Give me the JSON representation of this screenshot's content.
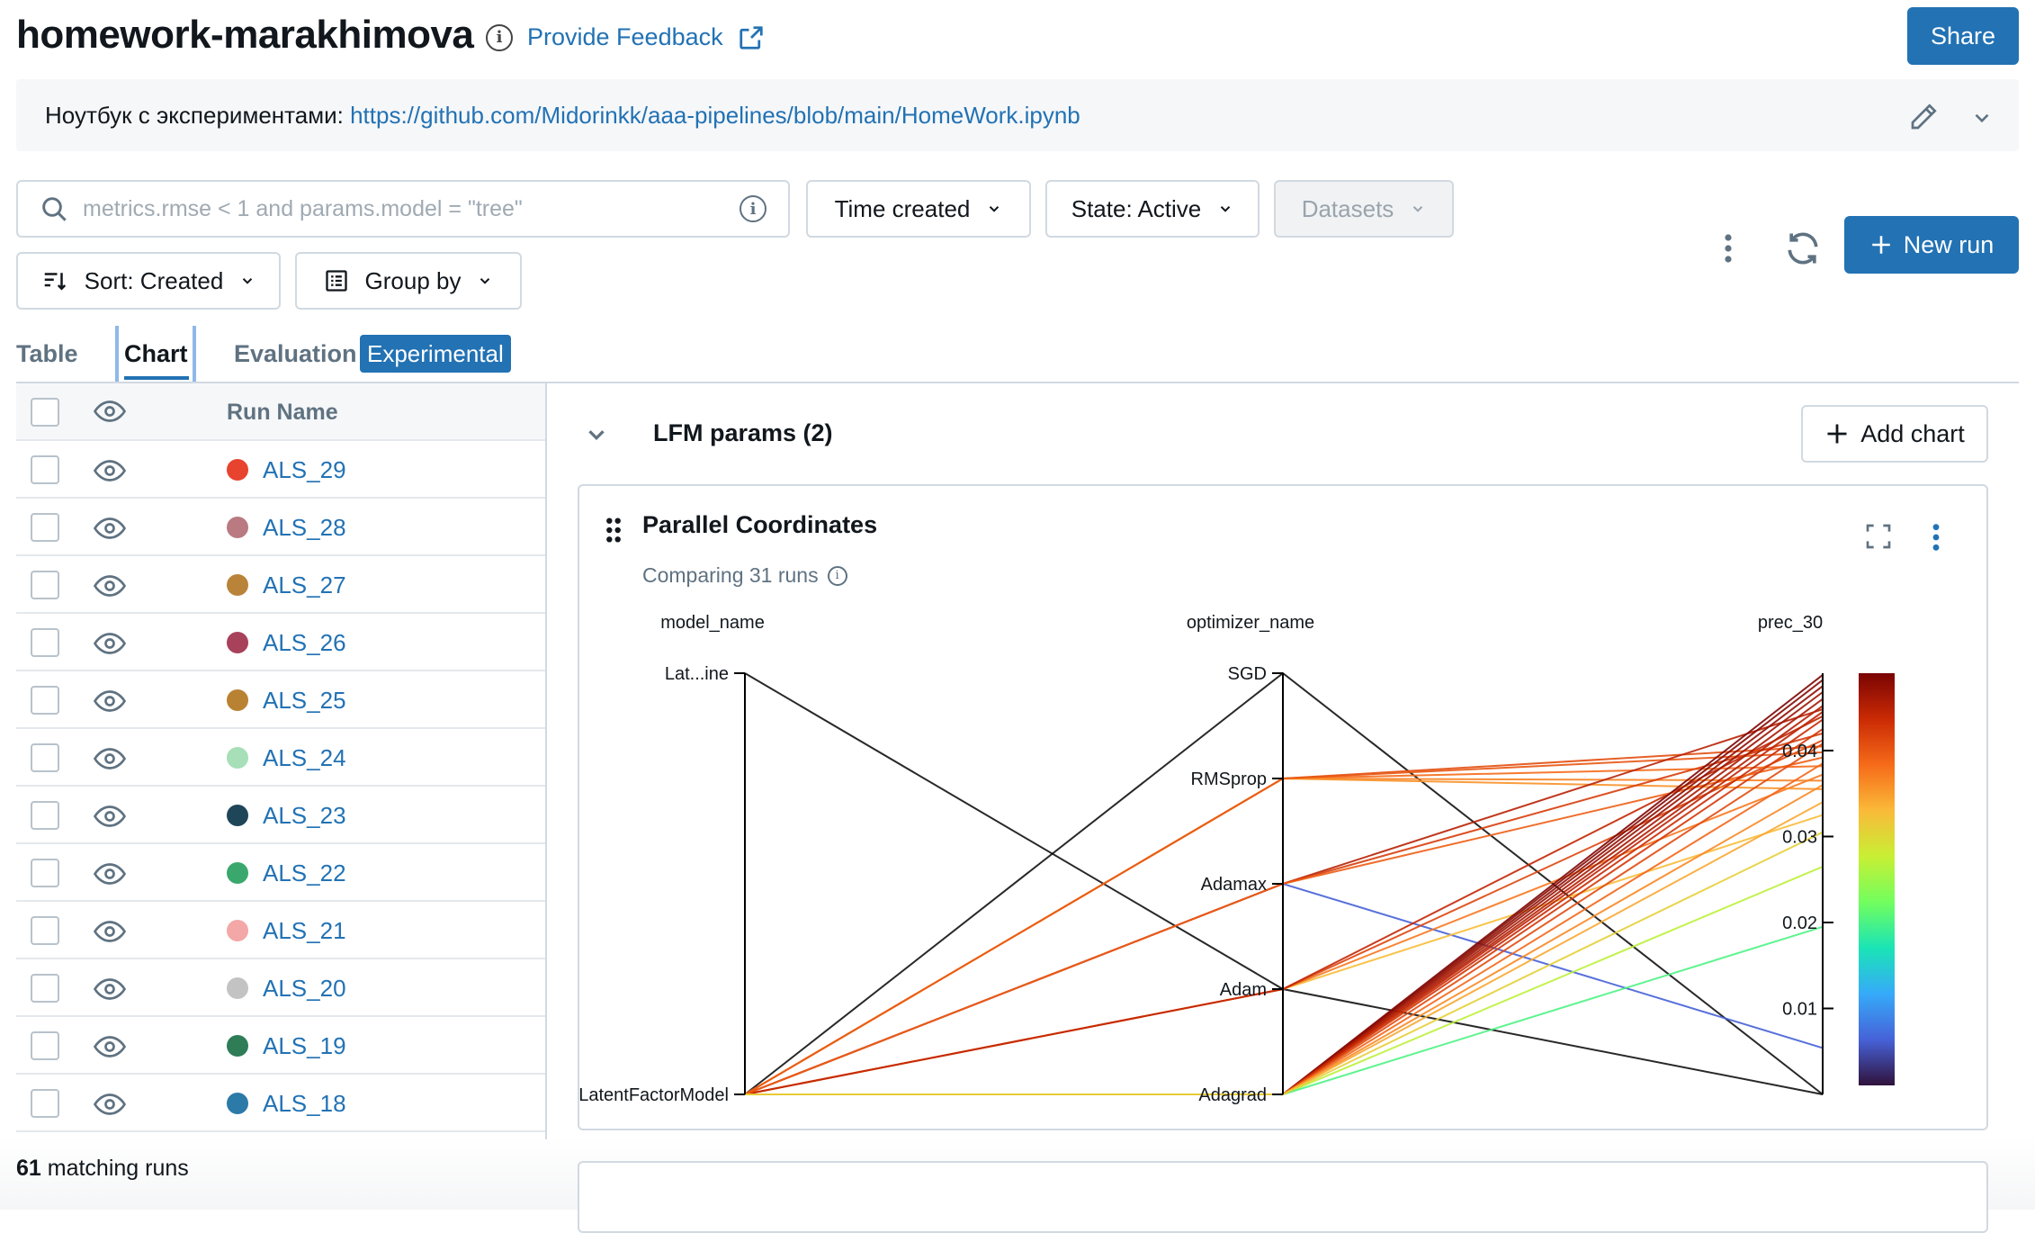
{
  "header": {
    "experiment_name": "homework-marakhimova",
    "feedback_label": "Provide Feedback",
    "share_label": "Share"
  },
  "description": {
    "prefix": "Ноутбук с экспериментами: ",
    "link": "https://github.com/Midorinkk/aaa-pipelines/blob/main/HomeWork.ipynb"
  },
  "controls": {
    "search_placeholder": "metrics.rmse < 1 and params.model = \"tree\"",
    "time_created": "Time created",
    "state": "State: Active",
    "datasets": "Datasets",
    "sort": "Sort: Created",
    "group_by": "Group by",
    "new_run": "New run"
  },
  "tabs": [
    {
      "label": "Table",
      "active": false
    },
    {
      "label": "Chart",
      "active": true
    },
    {
      "label": "Evaluation",
      "active": false
    }
  ],
  "experimental_badge": "Experimental",
  "runs_table": {
    "column_header": "Run Name",
    "rows": [
      {
        "name": "ALS_29",
        "color": "#e8432f"
      },
      {
        "name": "ALS_28",
        "color": "#b97a82"
      },
      {
        "name": "ALS_27",
        "color": "#b9843a"
      },
      {
        "name": "ALS_26",
        "color": "#a8415a"
      },
      {
        "name": "ALS_25",
        "color": "#b98233"
      },
      {
        "name": "ALS_24",
        "color": "#a6dfb8"
      },
      {
        "name": "ALS_23",
        "color": "#1f4559"
      },
      {
        "name": "ALS_22",
        "color": "#3aa86c"
      },
      {
        "name": "ALS_21",
        "color": "#f3a7a7"
      },
      {
        "name": "ALS_20",
        "color": "#c3c3c3"
      },
      {
        "name": "ALS_19",
        "color": "#2e7d57"
      },
      {
        "name": "ALS_18",
        "color": "#2b7aa8"
      }
    ],
    "matching_count": "61",
    "matching_label": " matching runs"
  },
  "chart_section": {
    "title": "LFM params (2)",
    "add_chart": "Add chart"
  },
  "chart_card": {
    "title": "Parallel Coordinates",
    "subtitle": "Comparing 31 runs"
  },
  "chart_data": {
    "type": "parallel_coordinates",
    "axes": [
      {
        "name": "model_name",
        "type": "categorical",
        "categories": [
          "LatentFactorModel",
          "Lat...ine"
        ]
      },
      {
        "name": "optimizer_name",
        "type": "categorical",
        "categories": [
          "Adagrad",
          "Adam",
          "Adamax",
          "RMSprop",
          "SGD"
        ]
      },
      {
        "name": "prec_30",
        "type": "numeric",
        "range": [
          0.0,
          0.049
        ],
        "ticks": [
          0.01,
          0.02,
          0.03,
          0.04
        ]
      }
    ],
    "colorscale": {
      "metric": "prec_30",
      "range": [
        0.0,
        0.049
      ],
      "colors": [
        "#30123b",
        "#4662d8",
        "#36aaf9",
        "#1ae4b6",
        "#72fe5e",
        "#c8ef34",
        "#faba39",
        "#f66b19",
        "#ca2a04",
        "#7a0403"
      ]
    },
    "runs": [
      {
        "model_name": "Lat...ine",
        "optimizer_name": "Adam",
        "prec_30": 0.0
      },
      {
        "model_name": "LatentFactorModel",
        "optimizer_name": "SGD",
        "prec_30": 0.0
      },
      {
        "model_name": "LatentFactorModel",
        "optimizer_name": "Adamax",
        "prec_30": 0.0054
      },
      {
        "model_name": "LatentFactorModel",
        "optimizer_name": "Adagrad",
        "prec_30": 0.0265
      },
      {
        "model_name": "LatentFactorModel",
        "optimizer_name": "Adagrad",
        "prec_30": 0.0195
      },
      {
        "model_name": "LatentFactorModel",
        "optimizer_name": "Adam",
        "prec_30": 0.0325
      },
      {
        "model_name": "LatentFactorModel",
        "optimizer_name": "Adam",
        "prec_30": 0.0372
      },
      {
        "model_name": "LatentFactorModel",
        "optimizer_name": "Adam",
        "prec_30": 0.0412
      },
      {
        "model_name": "LatentFactorModel",
        "optimizer_name": "Adam",
        "prec_30": 0.044
      },
      {
        "model_name": "LatentFactorModel",
        "optimizer_name": "RMSprop",
        "prec_30": 0.0405
      },
      {
        "model_name": "LatentFactorModel",
        "optimizer_name": "RMSprop",
        "prec_30": 0.0382
      },
      {
        "model_name": "LatentFactorModel",
        "optimizer_name": "RMSprop",
        "prec_30": 0.0365
      },
      {
        "model_name": "LatentFactorModel",
        "optimizer_name": "RMSprop",
        "prec_30": 0.0355
      },
      {
        "model_name": "LatentFactorModel",
        "optimizer_name": "RMSprop",
        "prec_30": 0.0398
      },
      {
        "model_name": "LatentFactorModel",
        "optimizer_name": "Adamax",
        "prec_30": 0.0448
      },
      {
        "model_name": "LatentFactorModel",
        "optimizer_name": "Adamax",
        "prec_30": 0.042
      },
      {
        "model_name": "LatentFactorModel",
        "optimizer_name": "Adamax",
        "prec_30": 0.0392
      },
      {
        "model_name": "LatentFactorModel",
        "optimizer_name": "Adagrad",
        "prec_30": 0.0488
      },
      {
        "model_name": "LatentFactorModel",
        "optimizer_name": "Adagrad",
        "prec_30": 0.0482
      },
      {
        "model_name": "LatentFactorModel",
        "optimizer_name": "Adagrad",
        "prec_30": 0.0475
      },
      {
        "model_name": "LatentFactorModel",
        "optimizer_name": "Adagrad",
        "prec_30": 0.0468
      },
      {
        "model_name": "LatentFactorModel",
        "optimizer_name": "Adagrad",
        "prec_30": 0.046
      },
      {
        "model_name": "LatentFactorModel",
        "optimizer_name": "Adagrad",
        "prec_30": 0.0452
      },
      {
        "model_name": "LatentFactorModel",
        "optimizer_name": "Adagrad",
        "prec_30": 0.0445
      },
      {
        "model_name": "LatentFactorModel",
        "optimizer_name": "Adagrad",
        "prec_30": 0.0436
      },
      {
        "model_name": "LatentFactorModel",
        "optimizer_name": "Adagrad",
        "prec_30": 0.0425
      },
      {
        "model_name": "LatentFactorModel",
        "optimizer_name": "Adagrad",
        "prec_30": 0.0408
      },
      {
        "model_name": "LatentFactorModel",
        "optimizer_name": "Adagrad",
        "prec_30": 0.0385
      },
      {
        "model_name": "LatentFactorModel",
        "optimizer_name": "Adagrad",
        "prec_30": 0.036
      },
      {
        "model_name": "LatentFactorModel",
        "optimizer_name": "Adagrad",
        "prec_30": 0.034
      },
      {
        "model_name": "LatentFactorModel",
        "optimizer_name": "Adagrad",
        "prec_30": 0.0305
      }
    ]
  }
}
